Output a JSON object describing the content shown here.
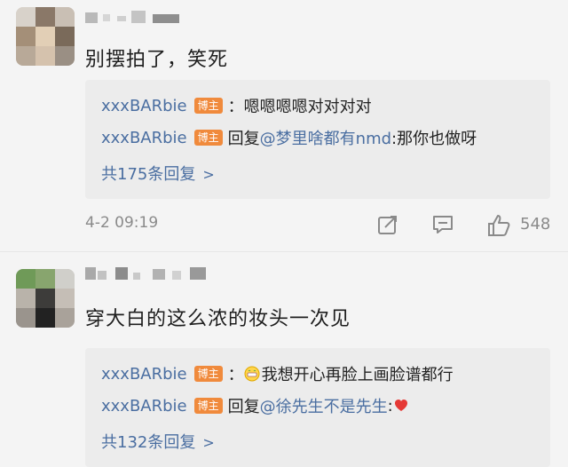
{
  "comments": [
    {
      "text": "别摆拍了，笑死",
      "replies": [
        {
          "user": "xxxBARbie",
          "badge": "博主",
          "body": "：嗯嗯嗯嗯对对对对"
        },
        {
          "user": "xxxBARbie",
          "badge": "博主",
          "prefix": "回复",
          "mention": "@梦里啥都有nmd",
          "body": ":那你也做呀"
        }
      ],
      "more_replies": "共175条回复",
      "timestamp": "4-2 09:19",
      "likes": "548"
    },
    {
      "text": "穿大白的这么浓的妆头一次见",
      "replies": [
        {
          "user": "xxxBARbie",
          "badge": "博主",
          "body": "我想开心再脸上画脸谱都行"
        },
        {
          "user": "xxxBARbie",
          "badge": "博主",
          "prefix": "回复",
          "mention": "@徐先生不是先生",
          "body": ":"
        }
      ],
      "more_replies": "共132条回复"
    }
  ],
  "icons": {
    "share": "share-icon",
    "comment": "comment-icon",
    "like": "thumbs-up-icon",
    "heart": "heart-emoji",
    "grin": "grin-emoji"
  },
  "colors": {
    "link": "#4a6ea1",
    "badge": "#f08a3c",
    "reply_bg": "#ececec",
    "page_bg": "#f4f4f4"
  }
}
